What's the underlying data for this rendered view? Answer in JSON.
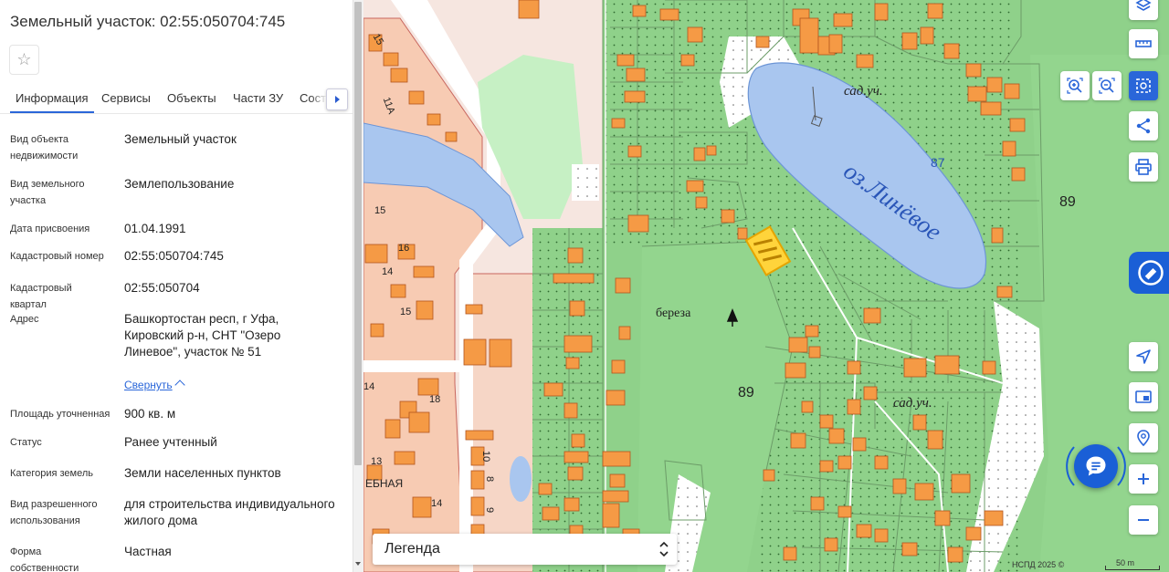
{
  "panel": {
    "title": "Земельный участок: 02:55:050704:745",
    "favorite_icon": "star-icon",
    "tabs": [
      {
        "label": "Информация",
        "active": true
      },
      {
        "label": "Сервисы",
        "active": false
      },
      {
        "label": "Объекты",
        "active": false
      },
      {
        "label": "Части ЗУ",
        "active": false
      },
      {
        "label": "Состав",
        "active": false
      }
    ],
    "tabs_next_icon": "chevron-right-icon",
    "fields": [
      {
        "label": "Вид объекта недвижимости",
        "value": "Земельный участок"
      },
      {
        "label": "Вид земельного участка",
        "value": "Землепользование"
      },
      {
        "label": "Дата присвоения",
        "value": "01.04.1991"
      },
      {
        "label": "Кадастровый номер",
        "value": "02:55:050704:745"
      },
      {
        "label": "Кадастровый квартал",
        "value": "02:55:050704"
      },
      {
        "label": "Адрес",
        "value": "Башкортостан респ, г Уфа, Кировский р-н, СНТ \"Озеро Линевое\", участок № 51"
      },
      {
        "label": "Площадь уточненная",
        "value": "900 кв. м"
      },
      {
        "label": "Статус",
        "value": "Ранее учтенный"
      },
      {
        "label": "Категория земель",
        "value": "Земли населенных пунктов"
      },
      {
        "label": "Вид разрешенного использования",
        "value": "для строительства индивидуального жилого дома"
      },
      {
        "label": "Форма собственности",
        "value": "Частная"
      }
    ],
    "collapse_label": "Свернуть"
  },
  "map": {
    "labels": {
      "lake": "оз.Линёвое",
      "sad1": "сад.уч.",
      "sad2": "сад.уч.",
      "bereza": "береза",
      "h87": "87",
      "h89a": "89",
      "h89b": "89",
      "n15": "15",
      "n14": "14",
      "n16": "16",
      "n13": "13",
      "n18": "18",
      "n10": "10",
      "n8": "8",
      "n9": "9",
      "n11a": "11А",
      "n15b": "15",
      "n14b": "14",
      "n15c": "15",
      "n14c": "14",
      "street": "ЕБНАЯ"
    },
    "legend_label": "Легенда",
    "attribution": "НСПД 2025 ©",
    "scale_label": "50 m",
    "controls": {
      "layers": "layers-icon",
      "ruler": "ruler-icon",
      "zoom_area_in": "zoom-area-in-icon",
      "zoom_area_out": "zoom-area-out-icon",
      "select_area": "select-area-icon",
      "share": "share-icon",
      "print": "print-icon",
      "assistant": "assistant-icon",
      "locate": "locate-icon",
      "minimap": "minimap-icon",
      "geo_search": "geo-search-icon",
      "zoom_in": "plus-icon",
      "zoom_out": "minus-icon",
      "chat": "chat-icon"
    },
    "colors": {
      "accent": "#2a66d9",
      "water": "#a9c6ef",
      "green": "#8fd18a",
      "building": "#f59a45",
      "parcel": "#f4e1d8",
      "selected": "#ffd43b"
    }
  }
}
